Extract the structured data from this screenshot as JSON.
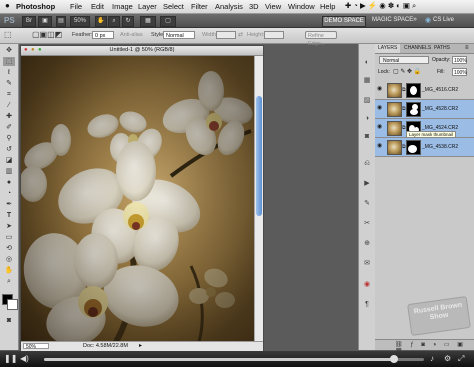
{
  "menubar": {
    "apple": "",
    "items": [
      "Photoshop",
      "File",
      "Edit",
      "Image",
      "Layer",
      "Select",
      "Filter",
      "Analysis",
      "3D",
      "View",
      "Window",
      "Help"
    ]
  },
  "appbar": {
    "logo": "PS",
    "zoom": "50%",
    "workspace": "DEMO SPACE",
    "magic_space": "MAGIC SPACE",
    "cs_live": "CS Live"
  },
  "options": {
    "feather_label": "Feather:",
    "feather_value": "0 px",
    "antialias": "Anti-alias",
    "style_label": "Style:",
    "style_value": "Normal",
    "width_label": "Width:",
    "height_label": "Height:",
    "refine": "Refine Edge..."
  },
  "document": {
    "title": "Untitled-1 @ 50% (RGB/8)",
    "zoom": "50%",
    "doc_size": "Doc: 4.58M/22.8M",
    "scroll_fraction": 0.35
  },
  "layers": {
    "tabs": [
      "LAYERS",
      "CHANNELS",
      "PATHS"
    ],
    "blend_mode": "Normal",
    "opacity_label": "Opacity:",
    "opacity": "100%",
    "lock_label": "Lock:",
    "fill_label": "Fill:",
    "fill": "100%",
    "rows": [
      {
        "name": "_MG_4516.CR2",
        "selected": false
      },
      {
        "name": "_MG_4528.CR2",
        "selected": true
      },
      {
        "name": "_MG_4524.CR2",
        "selected": true
      },
      {
        "name": "_MG_4538.CR2",
        "selected": true
      }
    ],
    "tooltip": "Layer mask thumbnail"
  },
  "watermark": "Russell Brown Show",
  "player": {
    "progress": 0.92
  },
  "colors": {
    "selection": "#9bbce4",
    "scroll_thumb": "#5d8fd0",
    "canvas_bg": "#a8864a"
  }
}
